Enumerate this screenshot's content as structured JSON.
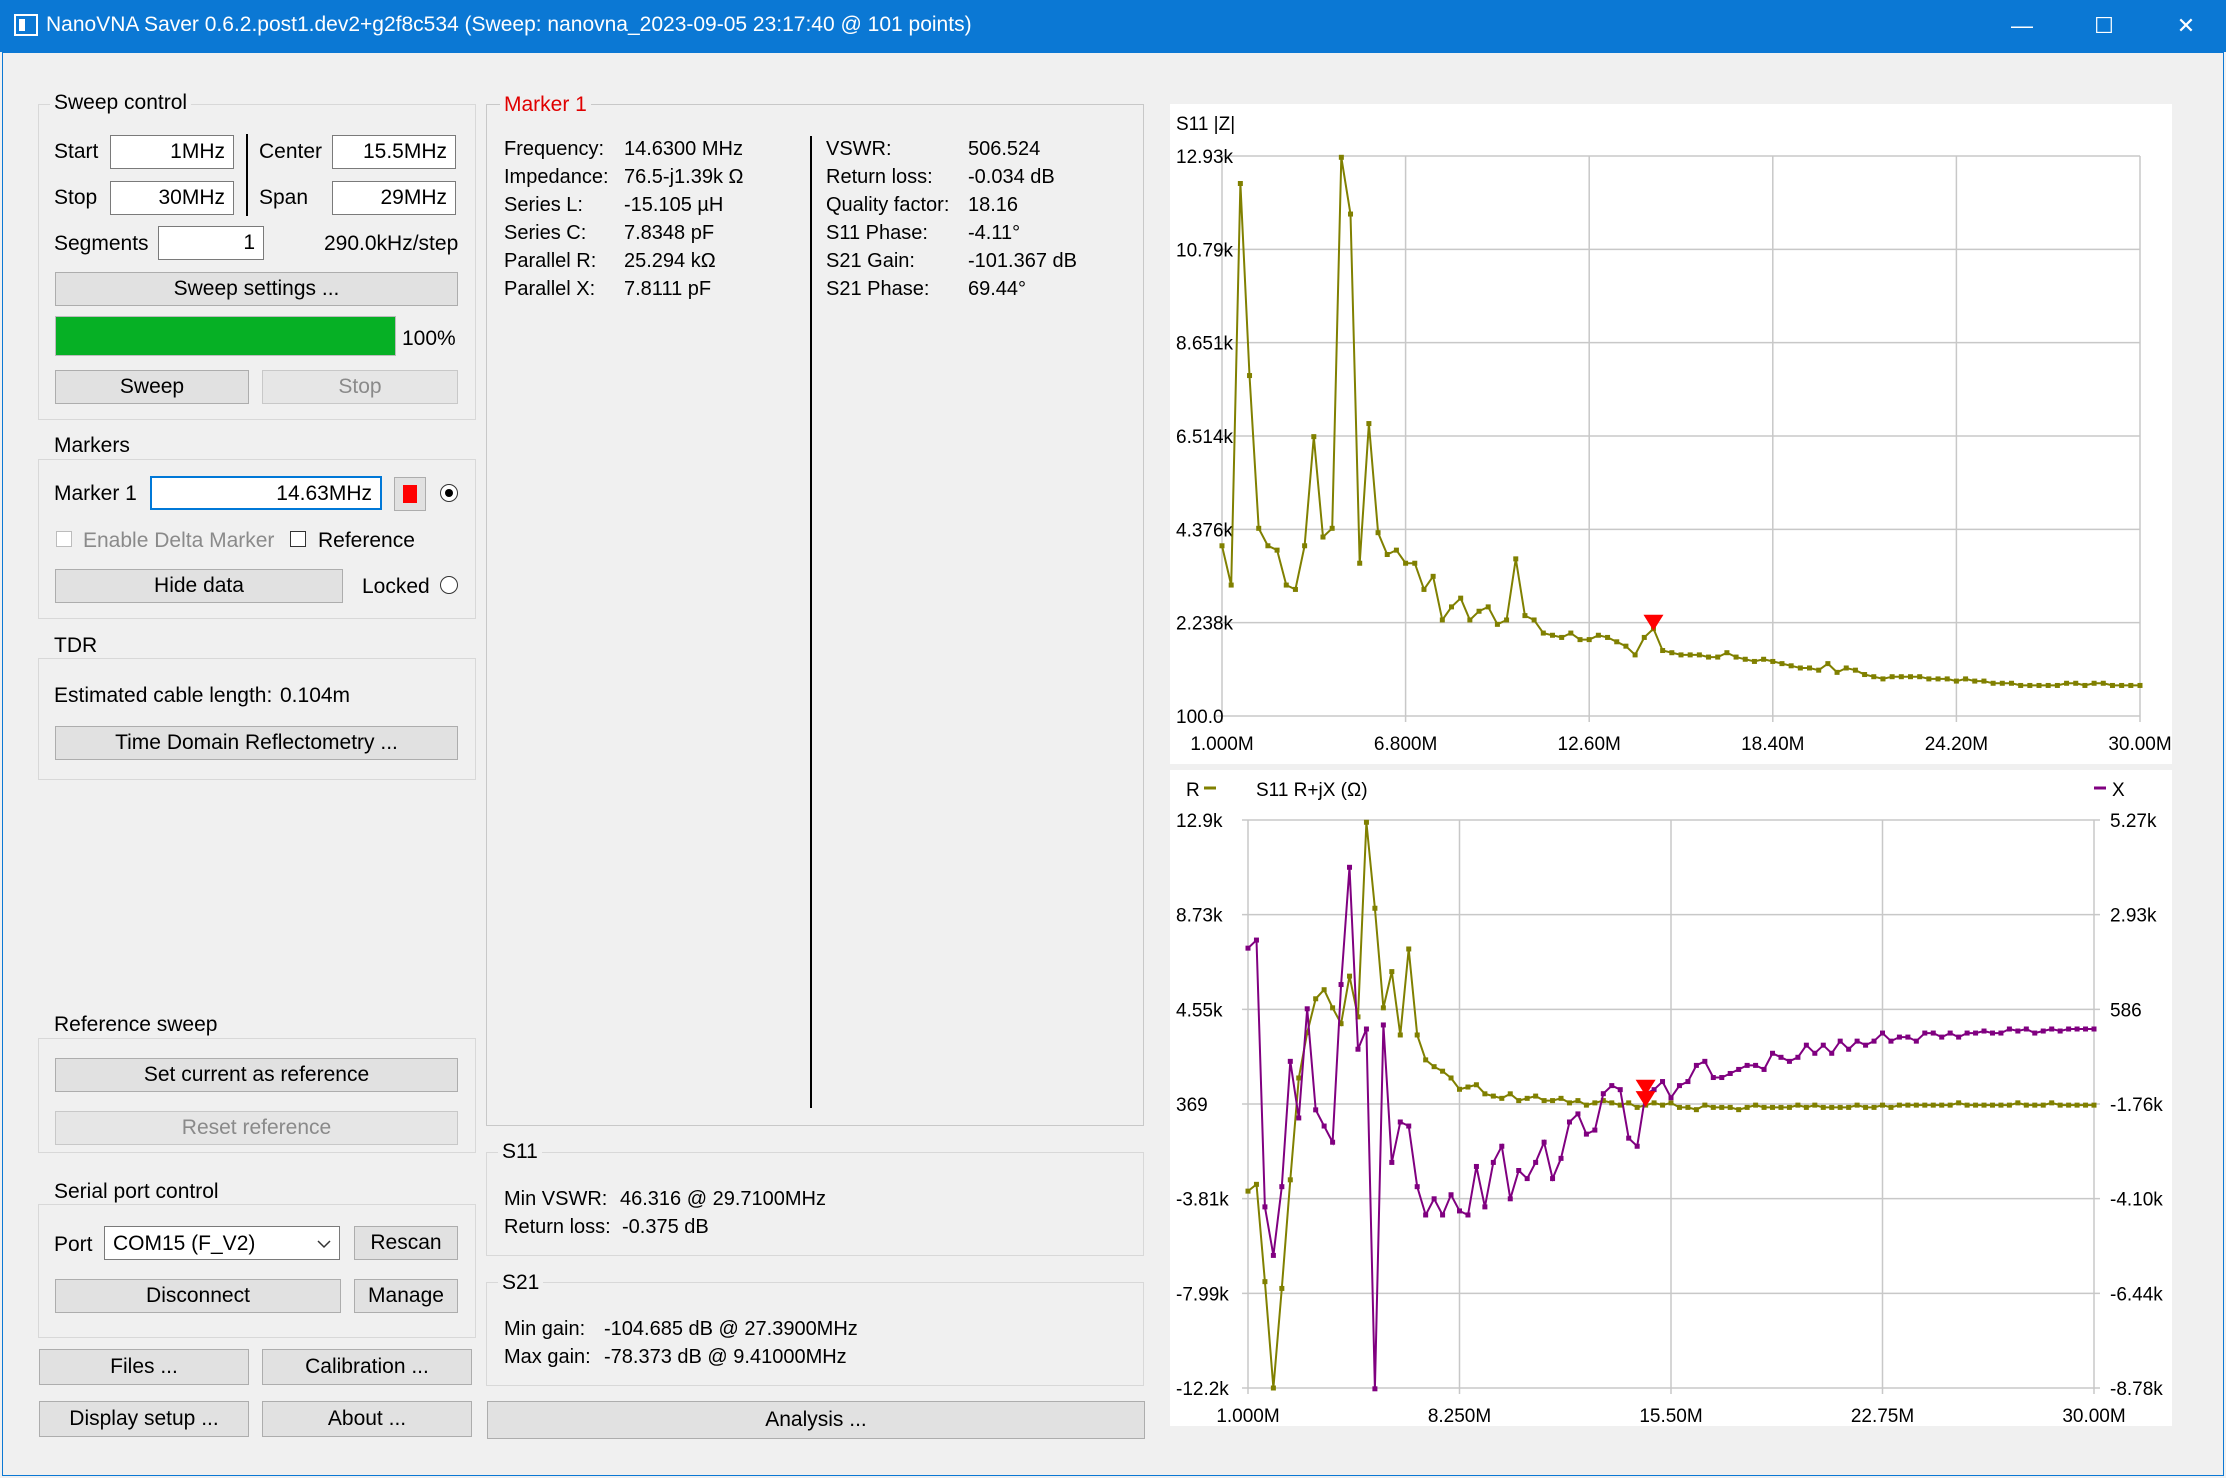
{
  "window": {
    "title": "NanoVNA Saver 0.6.2.post1.dev2+g2f8c534 (Sweep: nanovna_2023-09-05 23:17:40 @ 101 points)",
    "controls": [
      "—",
      "☐",
      "✕"
    ]
  },
  "sweep_control": {
    "title": "Sweep control",
    "start_label": "Start",
    "start_value": "1MHz",
    "stop_label": "Stop",
    "stop_value": "30MHz",
    "center_label": "Center",
    "center_value": "15.5MHz",
    "span_label": "Span",
    "span_value": "29MHz",
    "segments_label": "Segments",
    "segments_value": "1",
    "step_text": "290.0kHz/step",
    "settings_button": "Sweep settings ...",
    "progress": 100,
    "progress_text": "100%",
    "sweep_button": "Sweep",
    "stop_button": "Stop"
  },
  "markers": {
    "title": "Markers",
    "marker1_label": "Marker 1",
    "marker1_value": "14.63MHz",
    "marker1_color": "#ff0000",
    "delta_label": "Enable Delta Marker",
    "reference_label": "Reference",
    "hide_button": "Hide data",
    "locked_label": "Locked"
  },
  "tdr": {
    "title": "TDR",
    "cable_label": "Estimated cable length:",
    "cable_value": "0.104m",
    "button": "Time Domain Reflectometry ..."
  },
  "reference_sweep": {
    "title": "Reference sweep",
    "set_button": "Set current as reference",
    "reset_button": "Reset reference"
  },
  "serial": {
    "title": "Serial port control",
    "port_label": "Port",
    "port_value": "COM15 (F_V2)",
    "rescan_button": "Rescan",
    "disconnect_button": "Disconnect",
    "manage_button": "Manage"
  },
  "bottom_buttons": {
    "files": "Files ...",
    "calibration": "Calibration ...",
    "display": "Display setup ...",
    "about": "About ...",
    "analysis": "Analysis ..."
  },
  "marker_panel": {
    "title": "Marker 1",
    "left": [
      {
        "k": "Frequency:",
        "v": "14.6300 MHz"
      },
      {
        "k": "Impedance:",
        "v": "76.5-j1.39k Ω"
      },
      {
        "k": "Series L:",
        "v": "-15.105 µH"
      },
      {
        "k": "Series C:",
        "v": "7.8348 pF"
      },
      {
        "k": "Parallel R:",
        "v": "25.294 kΩ"
      },
      {
        "k": "Parallel X:",
        "v": "7.8111 pF"
      }
    ],
    "right": [
      {
        "k": "VSWR:",
        "v": "506.524"
      },
      {
        "k": "Return loss:",
        "v": "-0.034 dB"
      },
      {
        "k": "Quality factor:",
        "v": "18.16"
      },
      {
        "k": "S11 Phase:",
        "v": "-4.11°"
      },
      {
        "k": "S21 Gain:",
        "v": "-101.367 dB"
      },
      {
        "k": "S21 Phase:",
        "v": "69.44°"
      }
    ]
  },
  "s11_summary": {
    "title": "S11",
    "vswr_label": "Min VSWR:",
    "vswr_value": "46.316 @ 29.7100MHz",
    "rl_label": "Return loss:",
    "rl_value": "-0.375 dB"
  },
  "s21_summary": {
    "title": "S21",
    "min_label": "Min gain:",
    "min_value": "-104.685 dB @ 27.3900MHz",
    "max_label": "Max gain:",
    "max_value": "-78.373 dB @ 9.41000MHz"
  },
  "chart_data": [
    {
      "type": "line",
      "title": "S11 |Z|",
      "x_unit": "MHz",
      "xlim": [
        1.0,
        30.0
      ],
      "ylim": [
        100.0,
        12930
      ],
      "x_ticks": [
        "1.000M",
        "6.800M",
        "12.60M",
        "18.40M",
        "24.20M",
        "30.00M"
      ],
      "y_ticks": [
        "12.93k",
        "10.79k",
        "8.651k",
        "6.514k",
        "4.376k",
        "2.238k",
        "100.0"
      ],
      "grid": true,
      "color": "#808000",
      "marker_freq": 14.63,
      "marker_color": "#ff0000",
      "series": [
        {
          "values": [
            4000,
            3100,
            12300,
            7900,
            4400,
            4000,
            3900,
            3100,
            3000,
            4000,
            6500,
            4200,
            4400,
            12900,
            11600,
            3600,
            6800,
            4300,
            3800,
            3900,
            3600,
            3600,
            3000,
            3300,
            2300,
            2600,
            2800,
            2300,
            2500,
            2600,
            2200,
            2300,
            3700,
            2400,
            2300,
            2000,
            1950,
            1900,
            2000,
            1850,
            1850,
            1950,
            1900,
            1800,
            1700,
            1500,
            1900,
            2100,
            1600,
            1550,
            1500,
            1500,
            1500,
            1450,
            1450,
            1550,
            1450,
            1400,
            1350,
            1400,
            1350,
            1300,
            1250,
            1200,
            1200,
            1150,
            1300,
            1100,
            1200,
            1150,
            1050,
            1000,
            950,
            1000,
            1000,
            1000,
            1000,
            950,
            950,
            950,
            900,
            950,
            900,
            900,
            850,
            850,
            850,
            800,
            800,
            800,
            800,
            800,
            850,
            850,
            800,
            850,
            850,
            800,
            800,
            800,
            800
          ]
        }
      ]
    },
    {
      "type": "line",
      "title": "S11 R+jX (Ω)",
      "x_unit": "MHz",
      "xlim": [
        1.0,
        30.0
      ],
      "ylim": [
        -12200,
        12900
      ],
      "y2lim": [
        -8780,
        5270
      ],
      "x_ticks": [
        "1.000M",
        "8.250M",
        "15.50M",
        "22.75M",
        "30.00M"
      ],
      "y_ticks": [
        "12.9k",
        "8.73k",
        "4.55k",
        "369",
        "-3.81k",
        "-7.99k",
        "-12.2k"
      ],
      "y2_ticks": [
        "5.27k",
        "2.93k",
        "586",
        "-1.76k",
        "-4.10k",
        "-6.44k",
        "-8.78k"
      ],
      "grid": true,
      "legend": [
        {
          "name": "R",
          "color": "#808000"
        },
        {
          "name": "X",
          "color": "#800080"
        }
      ],
      "marker_freq": 14.63,
      "marker_color": "#ff0000",
      "series": [
        {
          "name": "R",
          "color": "#808000",
          "axis": "left",
          "values": [
            -3500,
            -3200,
            -7500,
            -12200,
            -7800,
            -3000,
            1500,
            3500,
            5000,
            5400,
            4600,
            3900,
            6000,
            4200,
            12800,
            9000,
            4600,
            6200,
            3400,
            7200,
            3400,
            2300,
            2000,
            1800,
            1500,
            1000,
            1100,
            1200,
            800,
            700,
            600,
            800,
            500,
            600,
            700,
            500,
            500,
            600,
            400,
            500,
            300,
            400,
            500,
            400,
            300,
            400,
            200,
            300,
            400,
            300,
            400,
            200,
            200,
            100,
            300,
            200,
            200,
            200,
            100,
            200,
            300,
            200,
            200,
            200,
            200,
            300,
            200,
            300,
            200,
            200,
            200,
            200,
            300,
            200,
            200,
            300,
            200,
            300,
            300,
            300,
            300,
            300,
            300,
            300,
            400,
            300,
            300,
            300,
            300,
            300,
            300,
            400,
            300,
            300,
            300,
            400,
            300,
            300,
            300,
            300,
            300
          ]
        },
        {
          "name": "X",
          "color": "#800080",
          "axis": "right",
          "values": [
            2100,
            2300,
            -4300,
            -5500,
            -3800,
            -700,
            -2100,
            600,
            -1900,
            -2300,
            -2700,
            1200,
            4100,
            -400,
            100,
            -8800,
            200,
            -3200,
            -2200,
            -2300,
            -3800,
            -4500,
            -4100,
            -4500,
            -4000,
            -4400,
            -4500,
            -3300,
            -4300,
            -3200,
            -2800,
            -4100,
            -3400,
            -3600,
            -3200,
            -2700,
            -3600,
            -3100,
            -2200,
            -2000,
            -2500,
            -2400,
            -1500,
            -1300,
            -1400,
            -2600,
            -2800,
            -1500,
            -1400,
            -1200,
            -1600,
            -1300,
            -1200,
            -800,
            -700,
            -1100,
            -1100,
            -1000,
            -900,
            -800,
            -800,
            -900,
            -500,
            -600,
            -700,
            -600,
            -300,
            -500,
            -300,
            -500,
            -200,
            -400,
            -200,
            -300,
            -200,
            0,
            -200,
            -100,
            -100,
            -200,
            0,
            0,
            -100,
            0,
            -100,
            0,
            0,
            50,
            0,
            0,
            100,
            50,
            100,
            0,
            50,
            100,
            50,
            100,
            100,
            100,
            100
          ]
        }
      ]
    }
  ]
}
